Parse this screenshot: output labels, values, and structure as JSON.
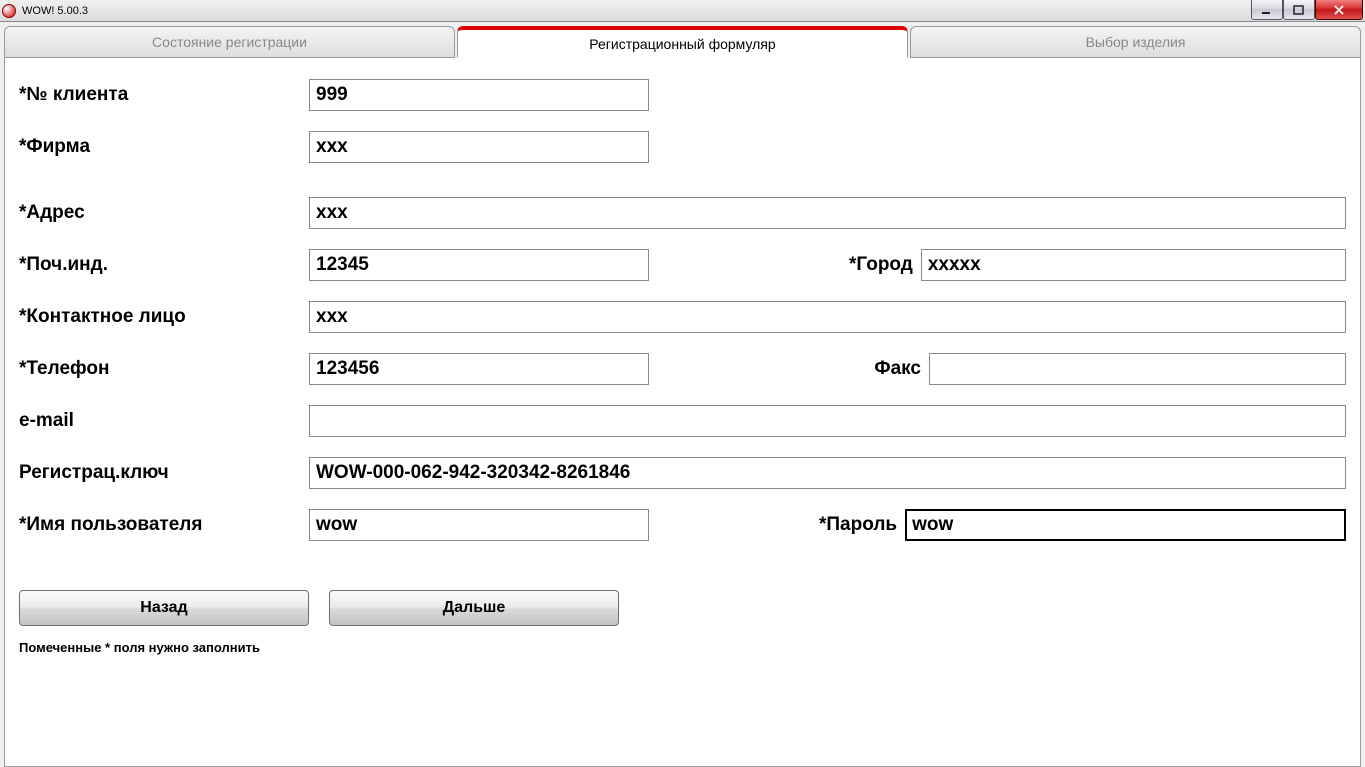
{
  "window": {
    "title": "WOW! 5.00.3"
  },
  "tabs": {
    "status": "Состояние регистрации",
    "form": "Регистрационный формуляр",
    "product": "Выбор изделия"
  },
  "labels": {
    "client_no": "*№ клиента",
    "company": "*Фирма",
    "address": "*Адрес",
    "zip": "*Поч.инд.",
    "city": "*Город",
    "contact": "*Контактное лицо",
    "phone": "*Телефон",
    "fax": "Факс",
    "email": "e-mail",
    "regkey": "Регистрац.ключ",
    "username": "*Имя пользователя",
    "password": "*Пароль"
  },
  "values": {
    "client_no": "999",
    "company": "xxx",
    "address": "xxx",
    "zip": "12345",
    "city": "xxxxx",
    "contact": "xxx",
    "phone": "123456",
    "fax": "",
    "email": "",
    "regkey": "WOW-000-062-942-320342-8261846",
    "username": "wow",
    "password": "wow"
  },
  "buttons": {
    "back": "Назад",
    "next": "Дальше"
  },
  "hint": "Помеченные * поля нужно заполнить"
}
